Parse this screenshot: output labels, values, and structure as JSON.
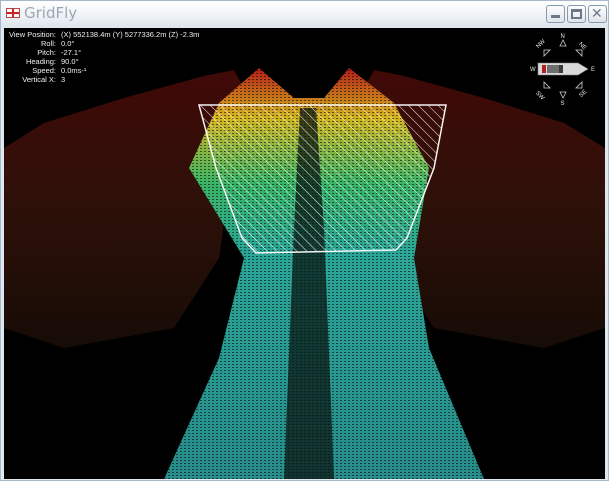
{
  "window": {
    "title": "GridFly"
  },
  "hud": [
    {
      "label": "View Position:",
      "value": "(X) 552138.4m (Y) 5277336.2m (Z) -2.3m"
    },
    {
      "label": "Roll:",
      "value": "0.0°"
    },
    {
      "label": "Pitch:",
      "value": "-27.1°"
    },
    {
      "label": "Heading:",
      "value": "90.0°"
    },
    {
      "label": "Speed:",
      "value": "0.0ms-¹"
    },
    {
      "label": "Vertical X:",
      "value": "3"
    }
  ],
  "compass": {
    "n": "N",
    "s": "S",
    "w": "W",
    "e": "E",
    "nw": "NW",
    "ne": "NE",
    "sw": "SW",
    "se": "SE"
  },
  "colors": {
    "background": "#000000",
    "seabed_near": "#35b9a8",
    "seabed_far": "#d83018",
    "overlay": "#ffffff"
  },
  "icons": [
    "flag-icon",
    "minimize-icon",
    "maximize-icon",
    "close-icon",
    "compass-rose-icon",
    "boat-heading-icon"
  ]
}
